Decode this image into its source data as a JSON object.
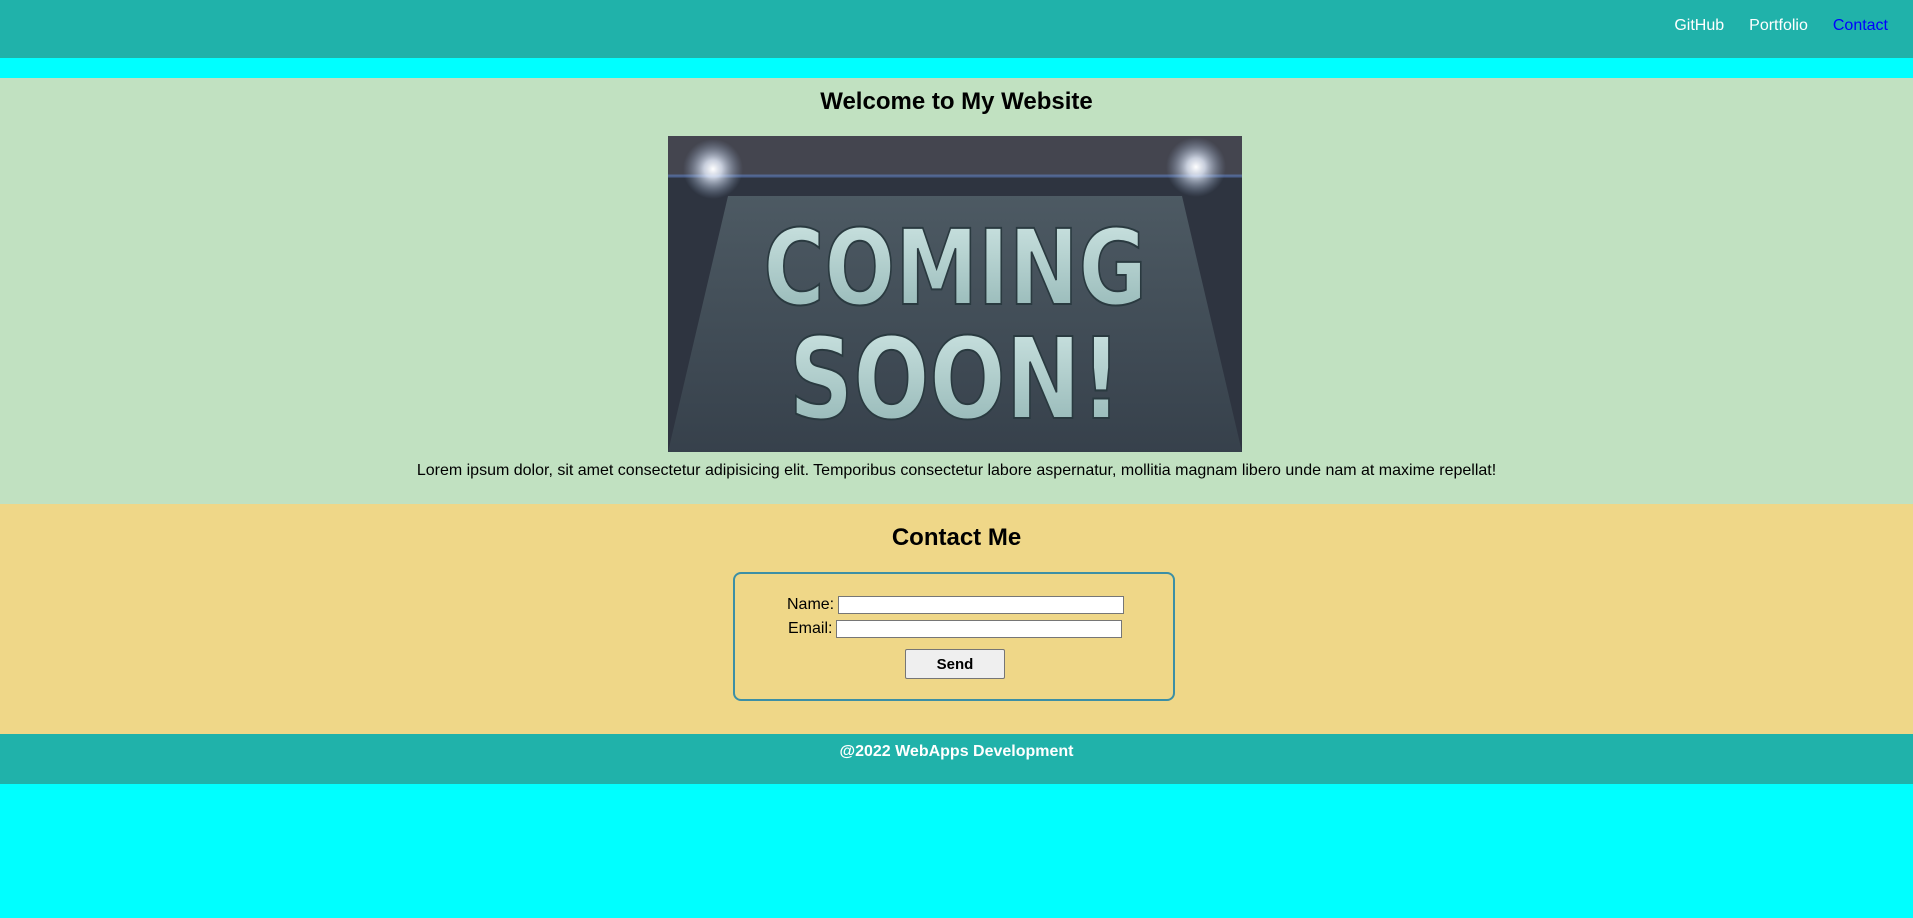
{
  "nav": {
    "items": [
      {
        "label": "GitHub"
      },
      {
        "label": "Portfolio"
      },
      {
        "label": "Contact"
      }
    ]
  },
  "welcome": {
    "title": "Welcome to My Website",
    "hero_image": {
      "line1": "COMING",
      "line2": "SOON!"
    },
    "paragraph": "Lorem ipsum dolor, sit amet consectetur adipisicing elit. Temporibus consectetur labore aspernatur, mollitia magnam libero unde nam at maxime repellat!"
  },
  "contact": {
    "title": "Contact Me",
    "name_label": "Name:",
    "name_value": "",
    "email_label": "Email:",
    "email_value": "",
    "send_label": "Send"
  },
  "footer": {
    "text": "@2022 WebApps Development"
  },
  "colors": {
    "header_bg": "#20b2aa",
    "page_bg": "#00ffff",
    "welcome_bg": "#c1e1c1",
    "contact_bg": "#efd788",
    "active_link": "#0000ff"
  }
}
